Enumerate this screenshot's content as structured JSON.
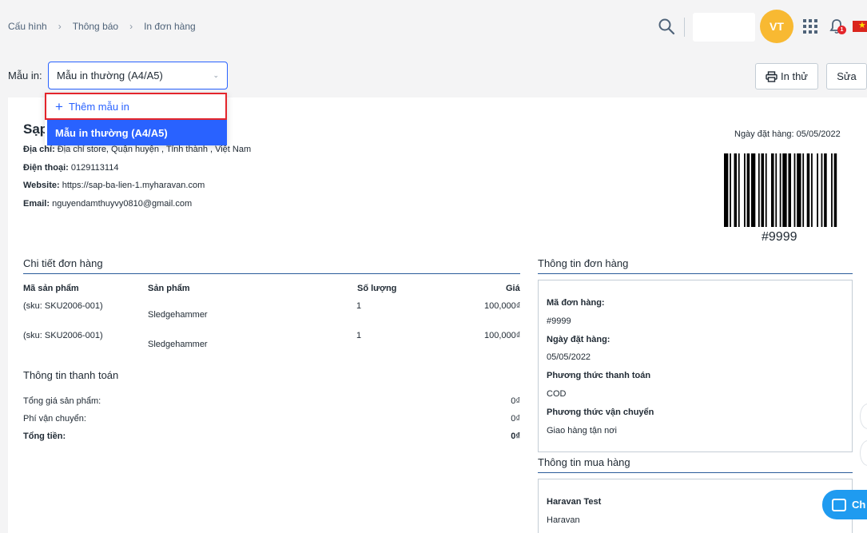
{
  "breadcrumb": {
    "items": [
      "Cấu hình",
      "Thông báo",
      "In đơn hàng"
    ]
  },
  "header": {
    "avatar_initials": "VT",
    "notification_count": "1"
  },
  "toolbar": {
    "template_label": "Mẫu in:",
    "template_selected": "Mẫu in thường (A4/A5)",
    "print_test_label": "In thử",
    "edit_label": "Sửa"
  },
  "dropdown": {
    "add_label": "Thêm mẫu in",
    "options": [
      "Mẫu in thường (A4/A5)"
    ]
  },
  "store": {
    "name": "Sạp",
    "address_label": "Địa chỉ:",
    "address": "Địa chỉ store, Quận huyện , Tỉnh thành , Việt Nam",
    "phone_label": "Điện thoại:",
    "phone": "0129113114",
    "website_label": "Website:",
    "website": "https://sap-ba-lien-1.myharavan.com",
    "email_label": "Email:",
    "email": "nguyendamthuyvy0810@gmail.com"
  },
  "order_header": {
    "date_text": "Ngày đặt hàng: 05/05/2022",
    "barcode_number": "#9999"
  },
  "order_details": {
    "title": "Chi tiết đơn hàng",
    "columns": [
      "Mã sản phẩm",
      "Sản phẩm",
      "Số lượng",
      "Giá"
    ],
    "rows": [
      {
        "sku": "(sku: SKU2006-001)",
        "product": "Sledgehammer",
        "qty": "1",
        "price": "100,000₫"
      },
      {
        "sku": "(sku: SKU2006-001)",
        "product": "Sledgehammer",
        "qty": "1",
        "price": "100,000₫"
      }
    ]
  },
  "payment": {
    "title": "Thông tin thanh toán",
    "rows": [
      {
        "label": "Tổng giá sản phẩm:",
        "value": "0₫"
      },
      {
        "label": "Phí vận chuyển:",
        "value": "0₫"
      },
      {
        "label": "Tổng tiền:",
        "value": "0₫"
      }
    ]
  },
  "order_info": {
    "title": "Thông tin đơn hàng",
    "order_code_label": "Mã đơn hàng:",
    "order_code": "#9999",
    "order_date_label": "Ngày đặt hàng:",
    "order_date": "05/05/2022",
    "payment_method_label": "Phương thức thanh toán",
    "payment_method": "COD",
    "shipping_method_label": "Phương thức vận chuyển",
    "shipping_method": "Giao hàng tận nơi"
  },
  "buyer_info": {
    "title": "Thông tin mua hàng",
    "name": "Haravan Test",
    "company": "Haravan"
  },
  "chat": {
    "label": "Ch"
  },
  "colors": {
    "accent": "#2962ff",
    "avatar": "#f8b932",
    "highlight_border": "#e4252b"
  }
}
